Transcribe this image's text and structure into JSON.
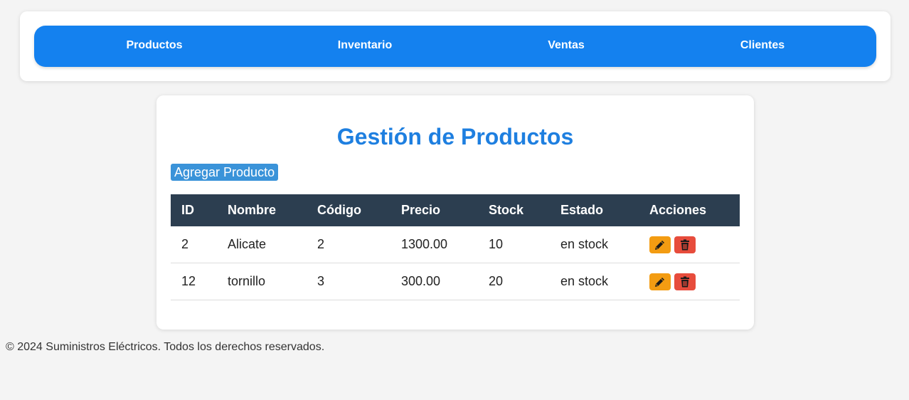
{
  "nav": {
    "items": [
      {
        "label": "Productos"
      },
      {
        "label": "Inventario"
      },
      {
        "label": "Ventas"
      },
      {
        "label": "Clientes"
      }
    ]
  },
  "main": {
    "title": "Gestión de Productos",
    "add_button_label": "Agregar Producto",
    "table": {
      "headers": [
        "ID",
        "Nombre",
        "Código",
        "Precio",
        "Stock",
        "Estado",
        "Acciones"
      ],
      "rows": [
        {
          "id": "2",
          "nombre": "Alicate",
          "codigo": "2",
          "precio": "1300.00",
          "stock": "10",
          "estado": "en stock"
        },
        {
          "id": "12",
          "nombre": "tornillo",
          "codigo": "3",
          "precio": "300.00",
          "stock": "20",
          "estado": "en stock"
        }
      ],
      "action_icons": [
        "pencil-icon",
        "trash-icon"
      ]
    }
  },
  "footer": {
    "text": "© 2024 Suministros Eléctricos. Todos los derechos reservados."
  },
  "colors": {
    "nav_bg": "#1481ef",
    "title": "#1e7fe0",
    "add_button": "#3a93d9",
    "table_header": "#2c3e50",
    "edit_button": "#f39c12",
    "delete_button": "#e74c3c"
  }
}
